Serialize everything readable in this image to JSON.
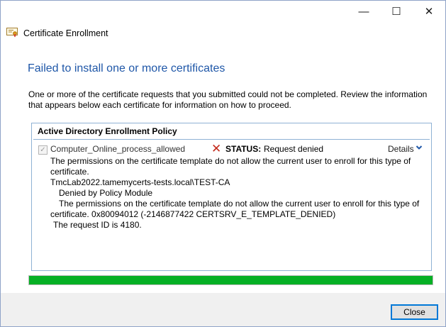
{
  "window": {
    "minimize_glyph": "—",
    "maximize_glyph": "☐",
    "close_glyph": "✕"
  },
  "header": {
    "title": "Certificate Enrollment"
  },
  "main": {
    "heading": "Failed to install one or more certificates",
    "intro_text": "One or more of the certificate requests that you submitted could not be completed. Review the information that appears below each certificate for information on how to proceed."
  },
  "policy": {
    "title": "Active Directory Enrollment Policy",
    "certificate": {
      "name": "Computer_Online_process_allowed",
      "checked": true,
      "status_label": "STATUS:",
      "status_value": "Request denied",
      "status_icon": "error-x-icon",
      "details_label": "Details",
      "details_icon": "chevron-down-icon"
    },
    "messages": {
      "line1": "The permissions on the certificate template do not allow the current user to enroll for this type of",
      "line2": "certificate.",
      "line3": "TmcLab2022.tamemycerts-tests.local\\TEST-CA",
      "line4": "Denied by Policy Module",
      "line5": "The permissions on the certificate template do not allow the current user to enroll for this type of",
      "line6": "certificate. 0x80094012 (-2146877422 CERTSRV_E_TEMPLATE_DENIED)",
      "line7": "The request ID is 4180."
    }
  },
  "progress": {
    "percent": 100,
    "color": "#06b025"
  },
  "footer": {
    "close_label": "Close"
  },
  "colors": {
    "heading": "#1f57a8",
    "error": "#c42b1c",
    "accent": "#0078d7"
  }
}
